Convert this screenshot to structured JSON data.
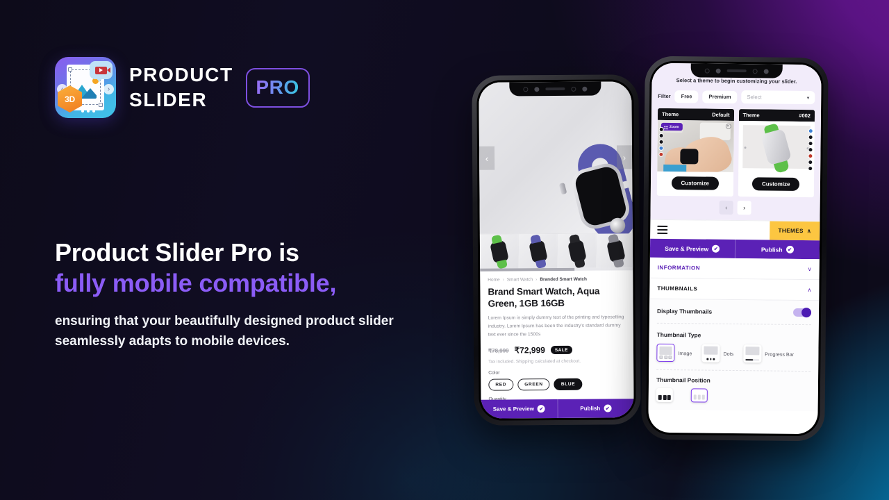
{
  "brand": {
    "name_line1": "PRODUCT",
    "name_line2": "SLIDER",
    "badge": "PRO",
    "logo_3d_label": "3D"
  },
  "headline": {
    "line1": "Product Slider Pro is",
    "line2": "fully mobile compatible,",
    "body": "ensuring that your beautifully designed product slider seamlessly adapts to mobile devices."
  },
  "colors": {
    "accent_purple": "#8b5cf6",
    "brand_purple": "#5b21b6",
    "themes_yellow": "#fcc641",
    "bg_dark": "#0d0b1a",
    "bg_violet": "#5a1383",
    "bg_teal": "#0579ad"
  },
  "phone1": {
    "breadcrumb": {
      "home": "Home",
      "category": "Smart Watch",
      "current": "Branded Smart Watch",
      "separator": "›"
    },
    "product_title": "Brand Smart Watch, Aqua Green, 1GB 16GB",
    "description": "Lorem Ipsum is simply dummy text of the printing and typesetting industry. Lorem Ipsum has been the industry's standard dummy text ever since the 1500s",
    "price_old": "₹78,999",
    "price_new": "₹72,999",
    "sale_badge": "SALE",
    "tax_note": "Tax included. Shipping calculated at checkout.",
    "color_label": "Color",
    "color_options": [
      "RED",
      "GREEN",
      "BLUE"
    ],
    "selected_color": "BLUE",
    "quantity_label": "Quantity",
    "prev_arrow": "‹",
    "next_arrow": "›",
    "bottom_bar": {
      "save": "Save & Preview",
      "publish": "Publish",
      "check": "✔"
    }
  },
  "phone2": {
    "hint": "Select a theme to begin customizing your slider.",
    "filter_label": "Filter",
    "filter_options": [
      "Free",
      "Premium"
    ],
    "select_placeholder": "Select",
    "chevron_down": "▾",
    "theme_cards": [
      {
        "label": "Theme",
        "value": "Default",
        "button": "Customize",
        "zoom_tag": "Zoom"
      },
      {
        "label": "Theme",
        "value": "#002",
        "button": "Customize"
      }
    ],
    "carousel": {
      "prev": "‹",
      "next": "›"
    },
    "toolbar": {
      "menu_icon": "hamburger-icon",
      "themes": "THEMES",
      "chevron_up": "∧"
    },
    "actions": {
      "save": "Save & Preview",
      "publish": "Publish",
      "check": "✔"
    },
    "sections": [
      {
        "title": "INFORMATION",
        "state": "collapsed",
        "chevron": "∨"
      },
      {
        "title": "THUMBNAILS",
        "state": "expanded",
        "chevron": "∧"
      }
    ],
    "thumbnails_panel": {
      "display_label": "Display Thumbnails",
      "display_on": true,
      "type_label": "Thumbnail Type",
      "types": [
        {
          "label": "Image",
          "selected": true
        },
        {
          "label": "Dots",
          "selected": false
        },
        {
          "label": "Progress Bar",
          "selected": false
        }
      ],
      "position_label": "Thumbnail Position"
    }
  }
}
